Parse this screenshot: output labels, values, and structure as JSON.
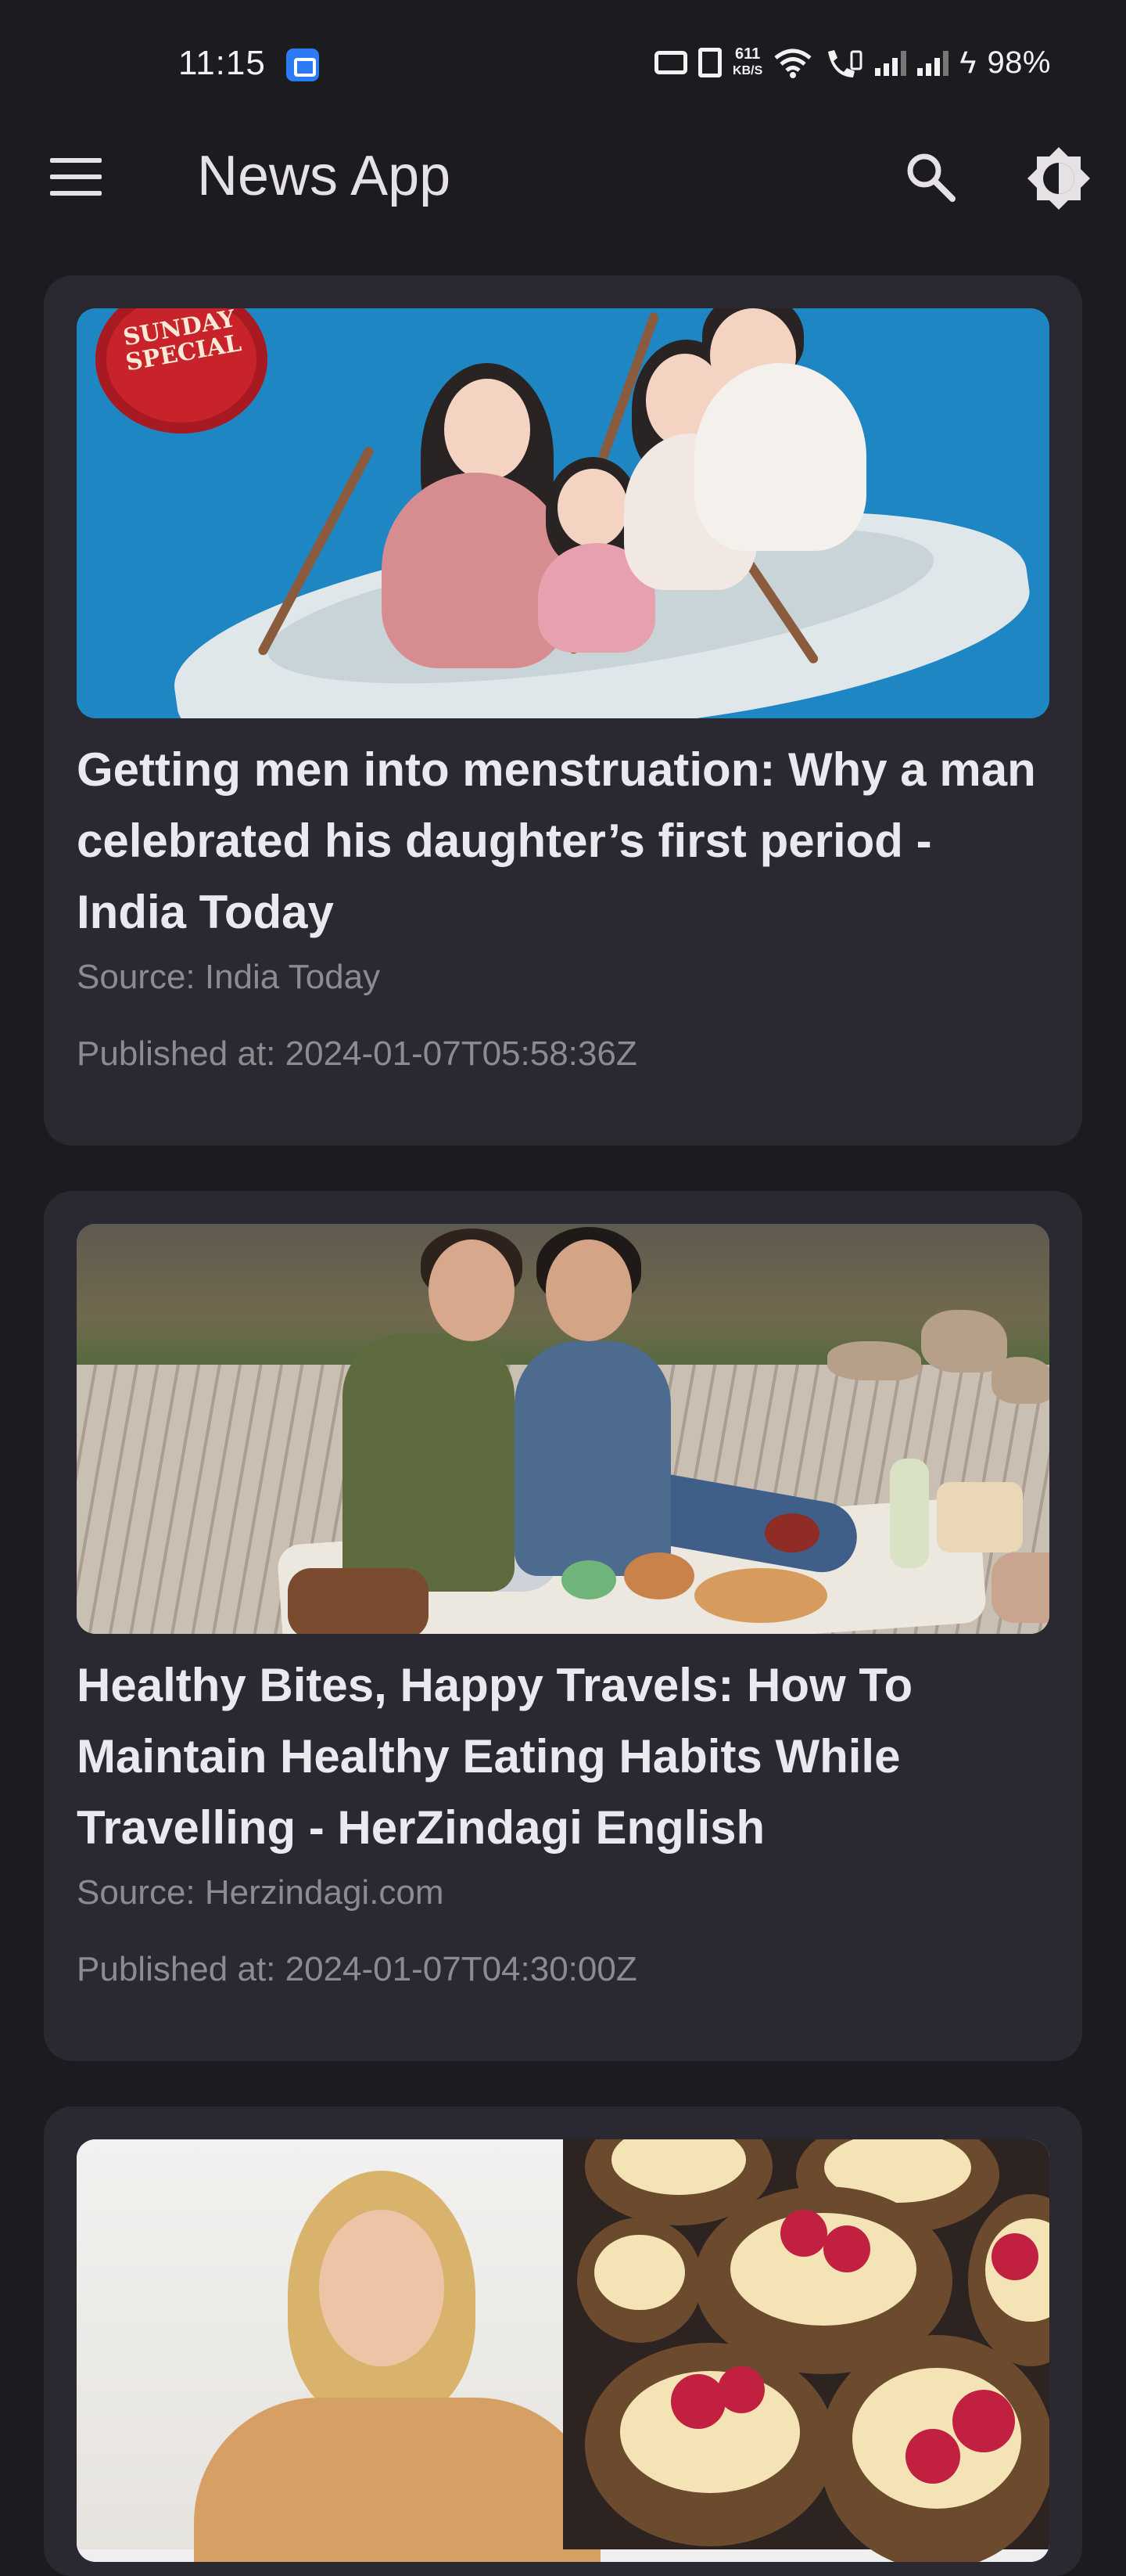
{
  "status_bar": {
    "time": "11:15",
    "speed_value": "611",
    "speed_unit": "KB/S",
    "battery": "98%"
  },
  "app_bar": {
    "title": "News App",
    "icons": [
      "menu-icon",
      "search-icon",
      "brightness-icon"
    ]
  },
  "articles": [
    {
      "title": "Getting men into menstruation: Why a man celebrated his daughter’s first period - India Today",
      "source": "Source: India Today",
      "published": "Published at: 2024-01-07T05:58:36Z",
      "image_badge_line1": "SUNDAY",
      "image_badge_line2": "SPECIAL"
    },
    {
      "title": "Healthy Bites, Happy Travels: How To Maintain Healthy Eating Habits While Travelling - HerZindagi English",
      "source": "Source: Herzindagi.com",
      "published": "Published at: 2024-01-07T04:30:00Z"
    },
    {
      "title": "",
      "source": "",
      "published": ""
    }
  ],
  "colors": {
    "background": "#1c1b20",
    "card": "#2a2830",
    "title_text": "#ece8ef",
    "meta_text": "#8e8a92"
  }
}
